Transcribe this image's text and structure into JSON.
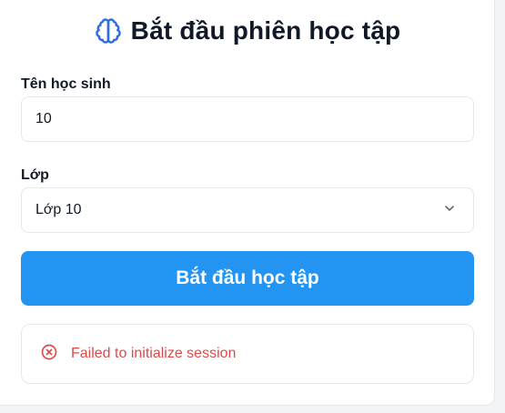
{
  "header": {
    "title": "Bắt đầu phiên học tập",
    "icon": "brain-icon",
    "icon_color": "#2f6de1"
  },
  "form": {
    "student_name": {
      "label": "Tên học sinh",
      "value": "10",
      "placeholder": ""
    },
    "grade": {
      "label": "Lớp",
      "selected": "Lớp 10",
      "icon": "chevron-down-icon"
    },
    "submit_label": "Bắt đầu học tập",
    "submit_color": "#2394f1"
  },
  "error": {
    "icon": "error-circle-icon",
    "message": "Failed to initialize session",
    "color": "#e04848"
  }
}
